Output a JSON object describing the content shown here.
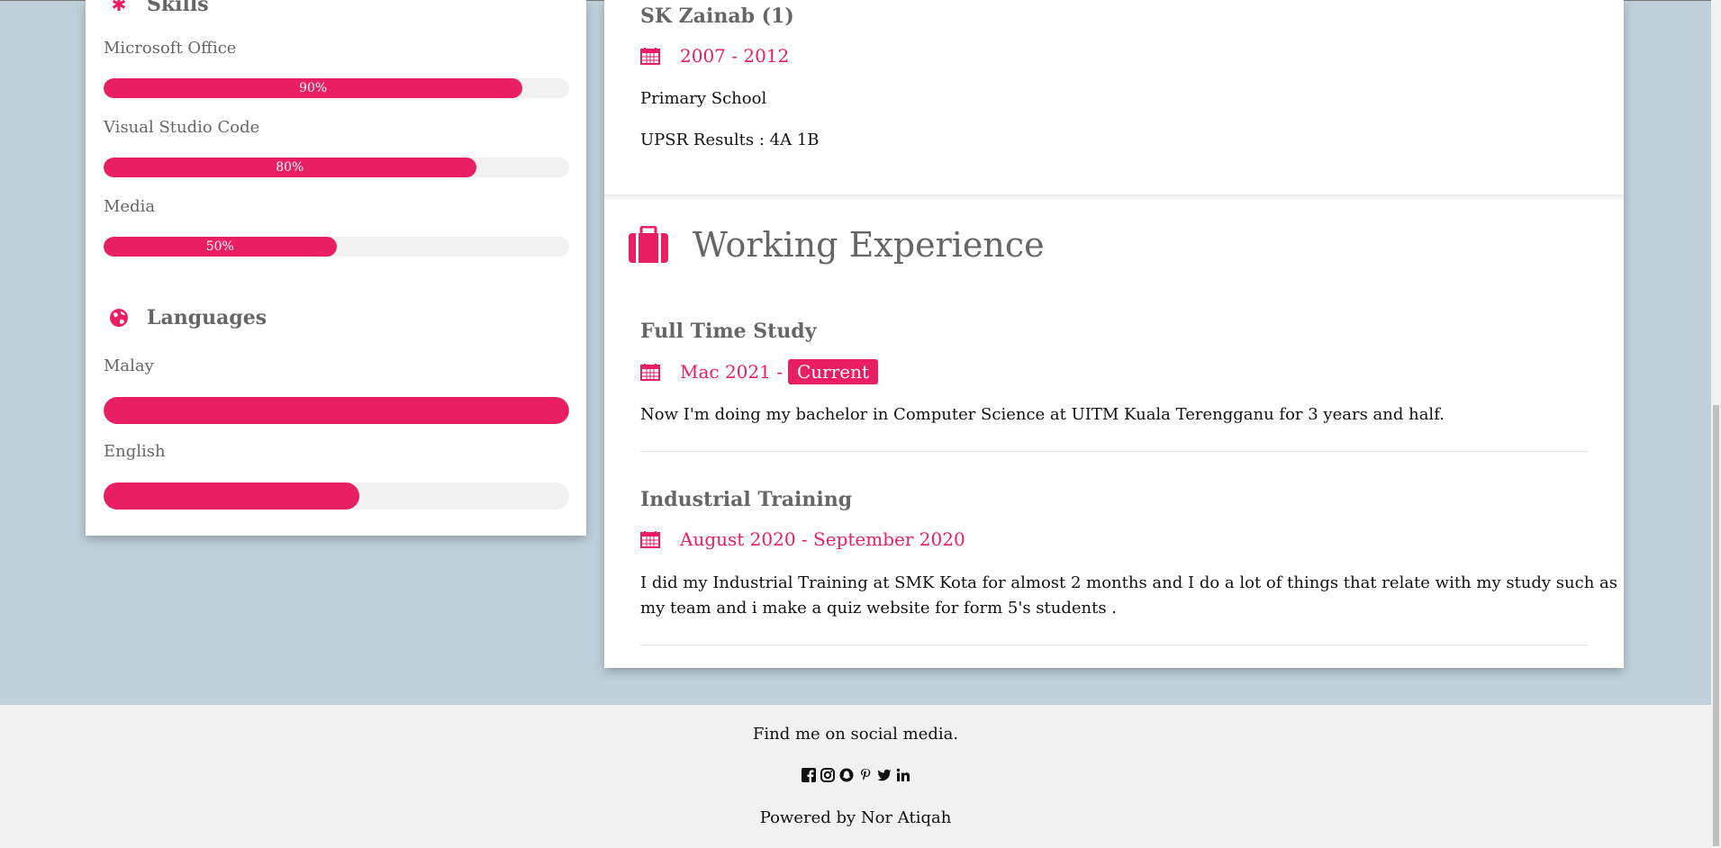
{
  "skills": {
    "title": "Skills",
    "items": [
      {
        "label": "Microsoft Office",
        "percent": 90,
        "percent_text": "90%"
      },
      {
        "label": "Visual Studio Code",
        "percent": 80,
        "percent_text": "80%"
      },
      {
        "label": "Media",
        "percent": 50,
        "percent_text": "50%"
      }
    ]
  },
  "languages": {
    "title": "Languages",
    "items": [
      {
        "label": "Malay",
        "percent": 100
      },
      {
        "label": "English",
        "percent": 55
      }
    ]
  },
  "education_last": {
    "title": "SK Zainab (1)",
    "date": "2007 - 2012",
    "line1": "Primary School",
    "line2": "UPSR Results : 4A 1B"
  },
  "experience": {
    "heading": "Working Experience",
    "items": [
      {
        "title": "Full Time Study",
        "date": "Mac 2021 -",
        "badge": "Current",
        "desc_lines": [
          "Now I'm doing my bachelor in Computer Science at UITM Kuala Terengganu for 3 years and half."
        ]
      },
      {
        "title": "Industrial Training",
        "date": "August 2020 - September 2020",
        "desc_lines": [
          "I did my Industrial Training at SMK Kota for almost 2 months and I do a lot of things that relate with my study such as",
          "my team and i make a quiz website for form 5's students ."
        ]
      }
    ]
  },
  "footer": {
    "find_text": "Find me on social media.",
    "powered_text": "Powered by Nor Atiqah",
    "social_icons": [
      "facebook-icon",
      "instagram-icon",
      "snapchat-icon",
      "pinterest-icon",
      "twitter-icon",
      "linkedin-icon"
    ]
  },
  "colors": {
    "accent": "#e91e63",
    "background": "#bfd0da",
    "footer": "#f1f1f1"
  }
}
